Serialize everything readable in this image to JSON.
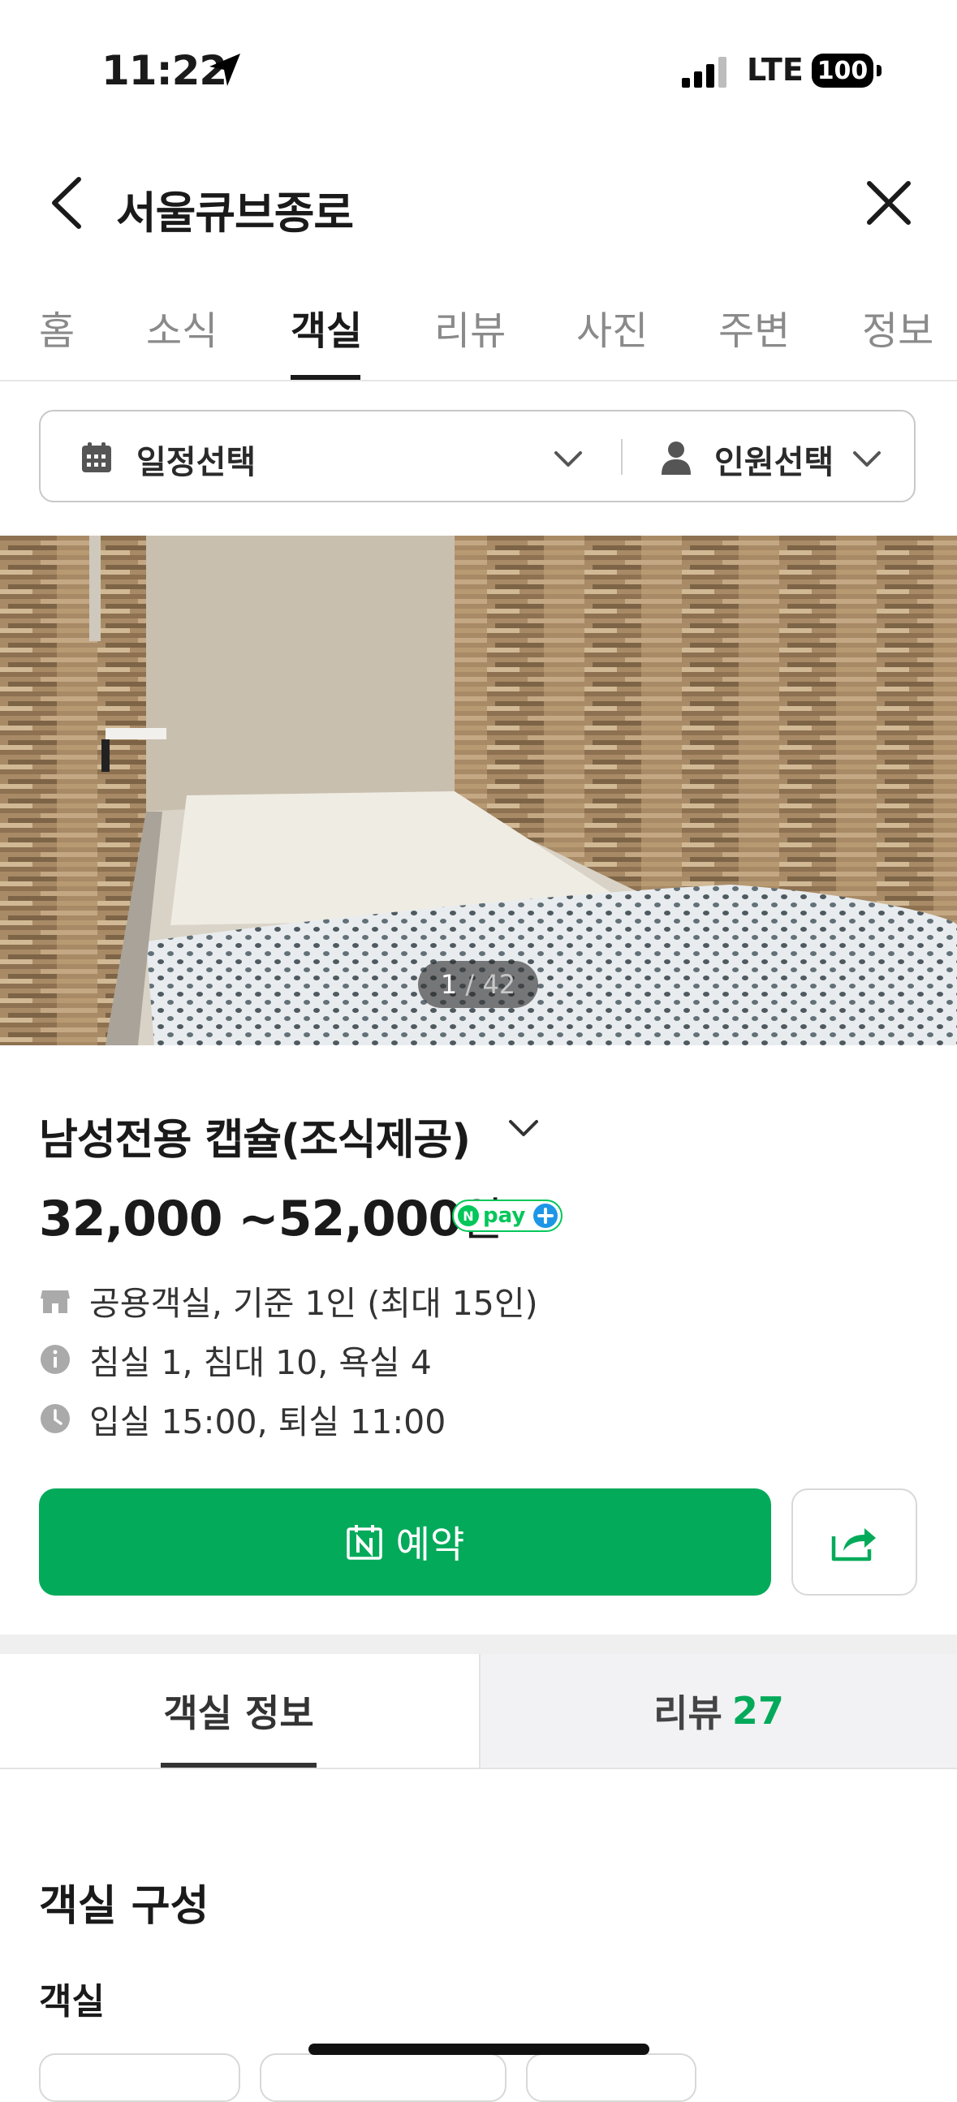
{
  "status_bar": {
    "time": "11:22",
    "network": "LTE",
    "battery": "100"
  },
  "header": {
    "title": "서울큐브종로"
  },
  "tabs": [
    {
      "label": "홈"
    },
    {
      "label": "소식"
    },
    {
      "label": "객실",
      "active": true
    },
    {
      "label": "리뷰"
    },
    {
      "label": "사진"
    },
    {
      "label": "주변"
    },
    {
      "label": "정보"
    }
  ],
  "filter": {
    "date_label": "일정선택",
    "guest_label": "인원선택"
  },
  "gallery": {
    "current": "1",
    "total": "/ 42"
  },
  "room": {
    "name": "남성전용 캡슐(조식제공)",
    "price_range": "32,000 ~52,000",
    "price_unit": "원",
    "pay_badge": "Npay+",
    "info": [
      {
        "icon": "building-icon",
        "text": "공용객실, 기준 1인 (최대 15인)"
      },
      {
        "icon": "info-icon",
        "text": "침실 1, 침대 10, 욕실 4"
      },
      {
        "icon": "clock-icon",
        "text": "입실 15:00, 퇴실 11:00"
      }
    ]
  },
  "actions": {
    "book_label": "예약"
  },
  "subtabs": {
    "info_label": "객실 정보",
    "review_label": "리뷰",
    "review_count": "27"
  },
  "section": {
    "title": "객실 구성",
    "subtitle": "객실"
  },
  "colors": {
    "accent": "#03aa5a",
    "text": "#1a1a1a"
  }
}
